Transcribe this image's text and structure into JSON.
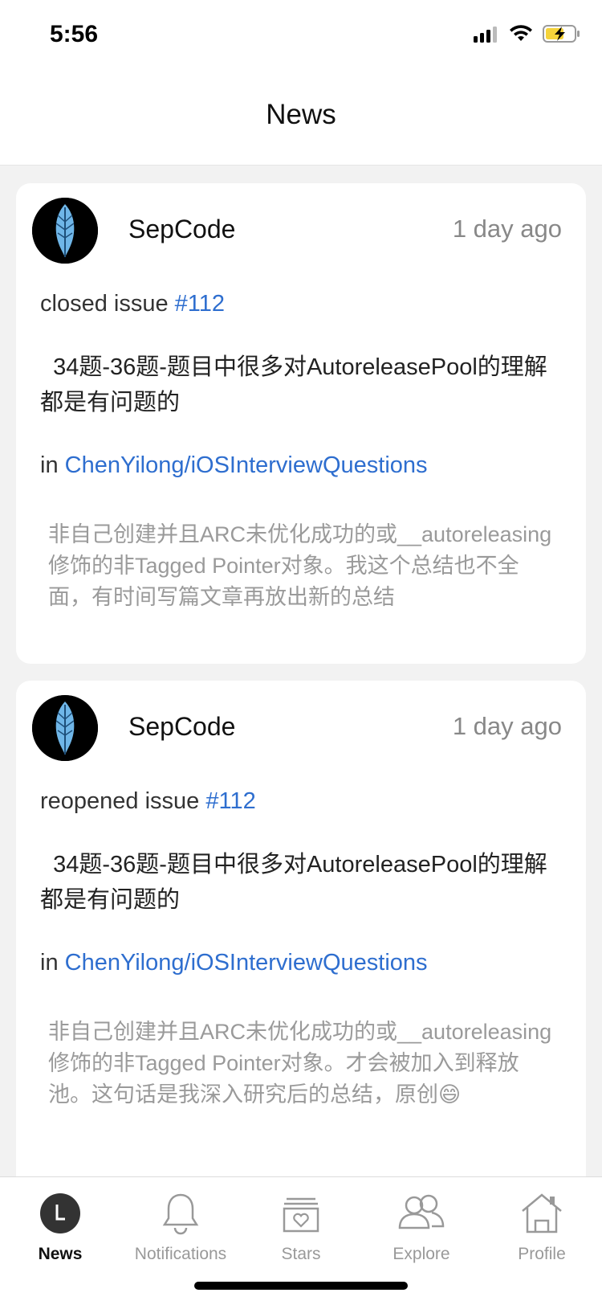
{
  "status_bar": {
    "time": "5:56"
  },
  "nav": {
    "title": "News"
  },
  "feed": [
    {
      "user": "SepCode",
      "time": "1 day ago",
      "action": "closed issue ",
      "issue_number": "#112",
      "issue_title": "  34题-36题-题目中很多对AutoreleasePool的理解都是有问题的",
      "repo_prefix": "in ",
      "repo": "ChenYilong/iOSInterviewQuestions",
      "comment": "非自己创建并且ARC未优化成功的或__autoreleasing修饰的非Tagged Pointer对象。我这个总结也不全面，有时间写篇文章再放出新的总结"
    },
    {
      "user": "SepCode",
      "time": "1 day ago",
      "action": "reopened issue ",
      "issue_number": "#112",
      "issue_title": "  34题-36题-题目中很多对AutoreleasePool的理解都是有问题的",
      "repo_prefix": "in ",
      "repo": "ChenYilong/iOSInterviewQuestions",
      "comment": "非自己创建并且ARC未优化成功的或__autoreleasing修饰的非Tagged Pointer对象。才会被加入到释放池。这句话是我深入研究后的总结，原创😄"
    }
  ],
  "tabs": [
    {
      "label": "News",
      "icon": "news-avatar-icon",
      "active": true
    },
    {
      "label": "Notifications",
      "icon": "bell-icon",
      "active": false
    },
    {
      "label": "Stars",
      "icon": "stars-heart-box-icon",
      "active": false
    },
    {
      "label": "Explore",
      "icon": "people-icon",
      "active": false
    },
    {
      "label": "Profile",
      "icon": "house-icon",
      "active": false
    }
  ],
  "colors": {
    "link": "#2e6ecf",
    "muted": "#9a9a9a",
    "battery": "#f5d33a"
  }
}
